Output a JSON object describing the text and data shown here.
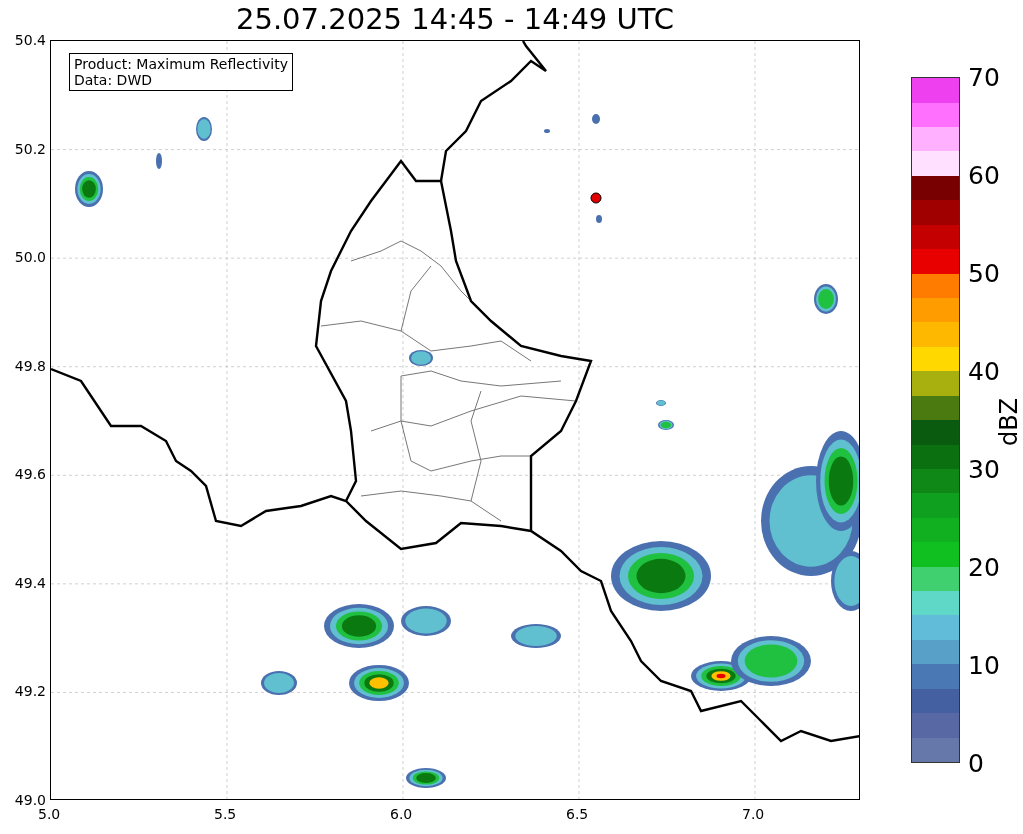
{
  "title": "25.07.2025 14:45 - 14:49 UTC",
  "legend": {
    "lines": [
      "Product: Maximum Reflectivity",
      "Data: DWD"
    ]
  },
  "x_ticks": [
    "5.0",
    "5.5",
    "6.0",
    "6.5",
    "7.0"
  ],
  "y_ticks": [
    "50.4",
    "50.2",
    "50.0",
    "49.8",
    "49.6",
    "49.4",
    "49.2",
    "49.0"
  ],
  "colorbar": {
    "label": "dBZ",
    "ticks": [
      "70",
      "60",
      "50",
      "40",
      "30",
      "20",
      "10",
      "0"
    ],
    "bands": [
      {
        "color": "#6677aa"
      },
      {
        "color": "#5868a5"
      },
      {
        "color": "#4460a0"
      },
      {
        "color": "#4a78b4"
      },
      {
        "color": "#58a0c8"
      },
      {
        "color": "#60bcd8"
      },
      {
        "color": "#60d8c8"
      },
      {
        "color": "#40d070"
      },
      {
        "color": "#10c020"
      },
      {
        "color": "#10b020"
      },
      {
        "color": "#10a020"
      },
      {
        "color": "#108818"
      },
      {
        "color": "#0a7010"
      },
      {
        "color": "#0a5a10"
      },
      {
        "color": "#4a7a10"
      },
      {
        "color": "#a8b010"
      },
      {
        "color": "#ffd800"
      },
      {
        "color": "#ffb800"
      },
      {
        "color": "#ff9c00"
      },
      {
        "color": "#ff7c00"
      },
      {
        "color": "#e80000"
      },
      {
        "color": "#c40000"
      },
      {
        "color": "#a00000"
      },
      {
        "color": "#780000"
      },
      {
        "color": "#ffe0ff"
      },
      {
        "color": "#ffb0ff"
      },
      {
        "color": "#ff70ff"
      },
      {
        "color": "#ee40ee"
      }
    ]
  }
}
